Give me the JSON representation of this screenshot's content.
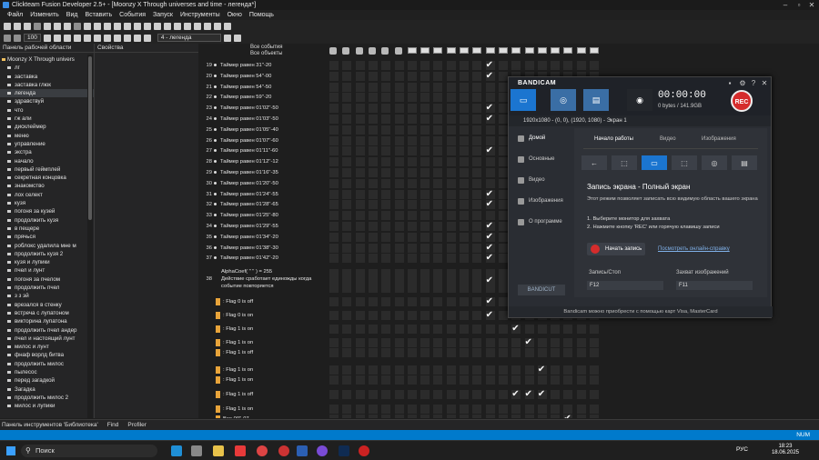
{
  "window": {
    "title": "Clickteam Fusion Developer 2.5+ - [Moonzy X  Through universes and time - легенда*]"
  },
  "menu": [
    "Файл",
    "Изменить",
    "Вид",
    "Вставить",
    "События",
    "Запуск",
    "Инструменты",
    "Окно",
    "Помощь"
  ],
  "toolbar": {
    "zoom": "100",
    "frame_select": "4 - легенда"
  },
  "workspace": {
    "title": "Панель рабочей области",
    "properties": "Свойства",
    "root": "Moonzy X  Through univers",
    "items": [
      "лг",
      "заставка",
      "заставка глюк",
      "легенда",
      "здравствуй",
      "что",
      "гж али",
      "дисклеймер",
      "меню",
      "управление",
      "экстра",
      "начало",
      "первый геймплей",
      "секретная концовка",
      "знакомство",
      "лох селект",
      "кузя",
      "погоня за кузей",
      "продолжить кузя",
      "в пещере",
      "прячься",
      "роблокс удалила мне м",
      "продолжить кузя 2",
      "кузя и лупики",
      "пчел и лунт",
      "погоня за пчелом",
      "продолжить пчел",
      "з з эй",
      "врезался в стенку",
      "встреча с лупатоном",
      "викторина лупатона",
      "продолжить пчел андер",
      "пчел и настоящий лунт",
      "милос и лунт",
      "фнаф ворлд битва",
      "продолжить милос",
      "пылесос",
      "перед загадкой",
      "Загадка",
      "продолжить милос 2",
      "милос и лупики"
    ],
    "selected": "легенда"
  },
  "events": {
    "header_all": "Все события",
    "header_objects": "Все объекты",
    "rows": [
      {
        "n": "19",
        "text": "Таймер равен 31''-20",
        "checks": [
          12
        ]
      },
      {
        "n": "20",
        "text": "Таймер равен 54''-00",
        "checks": [
          12
        ]
      },
      {
        "n": "21",
        "text": "Таймер равен 54''-50",
        "checks": [
          18
        ]
      },
      {
        "n": "22",
        "text": "Таймер равен 59''-20",
        "checks": [
          18
        ]
      },
      {
        "n": "23",
        "text": "Таймер равен 01'02''-50",
        "checks": [
          12,
          18
        ]
      },
      {
        "n": "24",
        "text": "Таймер равен 01'03''-50",
        "checks": [
          12
        ]
      },
      {
        "n": "25",
        "text": "Таймер равен 01'05''-40",
        "checks": [
          17
        ]
      },
      {
        "n": "26",
        "text": "Таймер равен 01'07''-60",
        "checks": [
          18
        ]
      },
      {
        "n": "27",
        "text": "Таймер равен 01'11''-60",
        "checks": [
          12,
          17
        ]
      },
      {
        "n": "28",
        "text": "Таймер равен 01'12''-12",
        "checks": [
          18
        ]
      },
      {
        "n": "29",
        "text": "Таймер равен 01'16''-35",
        "checks": [
          18
        ]
      },
      {
        "n": "30",
        "text": "Таймер равен 01'20''-50",
        "checks": [
          18
        ]
      },
      {
        "n": "31",
        "text": "Таймер равен 01'24''-55",
        "checks": [
          12,
          18
        ]
      },
      {
        "n": "32",
        "text": "Таймер равен 01'28''-65",
        "checks": [
          12,
          17
        ]
      },
      {
        "n": "33",
        "text": "Таймер равен 01'25''-80",
        "checks": [
          18
        ]
      },
      {
        "n": "34",
        "text": "Таймер равен 01'29''-55",
        "checks": [
          12,
          18
        ]
      },
      {
        "n": "35",
        "text": "Таймер равен 01'34''-20",
        "checks": [
          12,
          18
        ]
      },
      {
        "n": "36",
        "text": "Таймер равен 01'38''-30",
        "checks": [
          12,
          18
        ]
      },
      {
        "n": "37",
        "text": "Таймер равен 01'42''-20",
        "checks": [
          12,
          18
        ]
      }
    ],
    "ev38": {
      "n": "38",
      "line1": "AlphaCoef( \" \" ) = 255",
      "line2": "Действие сработает единожды когда",
      "line3": "событие повторяется"
    },
    "flags": [
      {
        "n": "39",
        "text": ": Flag 0 is off"
      },
      {
        "n": "40",
        "text": ": Flag 0 is on"
      },
      {
        "n": "41",
        "text": ": Flag 1 is on"
      },
      {
        "n": "42a",
        "text": ": Flag 1 is on"
      },
      {
        "n": "42b",
        "text": ": Flag 1 is off"
      },
      {
        "n": "43a",
        "text": ": Flag 1 is on"
      },
      {
        "n": "43b",
        "text": ": Flag 1 is on"
      },
      {
        "n": "44",
        "text": ": Flag 1 is off"
      },
      {
        "n": "45",
        "text": ": Flag 1 is on"
      },
      {
        "n": "",
        "text": "Все 00''-07"
      }
    ]
  },
  "bandicam": {
    "logo": "BANDICAM",
    "timer": "00:00:00",
    "bytes": "0 bytes / 141.9GB",
    "rec": "REC",
    "resolution": "1920x1080 - (0, 0), (1920, 1080) - Экран 1",
    "sidebar": [
      "Домой",
      "Основные",
      "Видео",
      "Изображения",
      "О программе"
    ],
    "tabs": [
      "Начало работы",
      "Видео",
      "Изображения"
    ],
    "heading": "Запись экрана - Полный экран",
    "desc": "Этот режим позволяет записать всю видимую область вашего экрана",
    "step1": "1. Выберите монитор для захвата",
    "step2": "2. Нажмите кнопку 'REC' или горячую клавишу записи",
    "start": "Начать запись",
    "help": "Посмотреть онлайн-справку",
    "hk_rec_label": "Запись/Стоп",
    "hk_rec": "F12",
    "hk_img_label": "Захват изображений",
    "hk_img": "F11",
    "bandicut": "BANDICUT",
    "footer": "Bandicam можно приобрести с помощью карт Visa, MasterCard"
  },
  "bottom": {
    "library": "Панель инструментов 'Библиотека'",
    "find": "Find",
    "profiler": "Profiler"
  },
  "status": "NUM",
  "taskbar": {
    "search": "Поиск",
    "lang": "РУС",
    "time": "18:23",
    "date": "18.06.2025"
  }
}
